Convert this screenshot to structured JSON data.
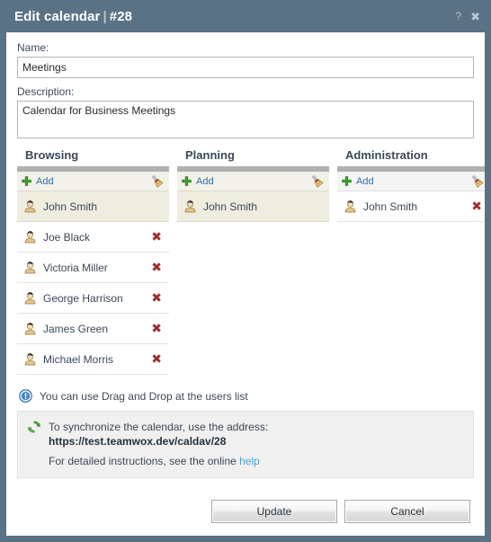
{
  "window": {
    "title": "Edit calendar",
    "separator": "|",
    "record_id": "#28",
    "help_button": "?",
    "close_button": "✖",
    "help_icon_name": "question-mark-icon",
    "close_icon_name": "close-icon"
  },
  "form": {
    "name_label": "Name:",
    "name_value": "Meetings",
    "name_placeholder": "",
    "description_label": "Description:",
    "description_value": "Calendar for Business Meetings",
    "description_placeholder": ""
  },
  "columns": [
    {
      "title": "Browsing",
      "add_label": "Add",
      "add_icon": "plus-icon",
      "clear_icon": "broom-icon",
      "users": [
        {
          "name": "John Smith",
          "highlighted": true,
          "removable": false
        },
        {
          "name": "Joe Black",
          "highlighted": false,
          "removable": true
        },
        {
          "name": "Victoria Miller",
          "highlighted": false,
          "removable": true
        },
        {
          "name": "George Harrison",
          "highlighted": false,
          "removable": true
        },
        {
          "name": "James Green",
          "highlighted": false,
          "removable": true
        },
        {
          "name": "Michael Morris",
          "highlighted": false,
          "removable": true
        }
      ]
    },
    {
      "title": "Planning",
      "add_label": "Add",
      "add_icon": "plus-icon",
      "clear_icon": "broom-icon",
      "users": [
        {
          "name": "John Smith",
          "highlighted": true,
          "removable": false
        }
      ]
    },
    {
      "title": "Administration",
      "add_label": "Add",
      "add_icon": "plus-icon",
      "clear_icon": "broom-icon",
      "users": [
        {
          "name": "John Smith",
          "highlighted": false,
          "removable": true
        }
      ]
    }
  ],
  "notes": {
    "dragdrop_icon": "info-icon",
    "dragdrop_text": "You can use Drag and Drop at the users list",
    "sync_icon": "sync-icon",
    "sync_line1": "To synchronize the calendar, use the address:",
    "sync_url": "https://test.teamwox.dev/caldav/28",
    "sync_line3_prefix": "For detailed instructions, see the online ",
    "sync_help_link": "help"
  },
  "footer": {
    "update_label": "Update",
    "cancel_label": "Cancel"
  },
  "colors": {
    "titlebar": "#5b7285",
    "accent_link": "#2f6fa8",
    "delete_red": "#9e2f2f",
    "add_green": "#3fa22e",
    "highlight_row": "#eeeddf",
    "help_link": "#4f9fd8"
  }
}
